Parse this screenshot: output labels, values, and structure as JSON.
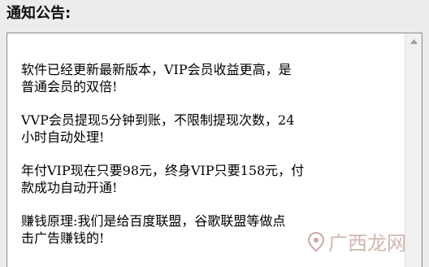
{
  "header": {
    "title": "通知公告:"
  },
  "notice": {
    "paragraphs": [
      "软件已经更新最新版本，VIP会员收益更高，是\n普通会员的双倍!",
      "VVP会员提现5分钟到账，不限制提现次数，24\n小时自动处理!",
      "年付VIP现在只要98元，终身VIP只要158元，付\n款成功自动开通!",
      "赚钱原理:我们是给百度联盟，谷歌联盟等做点\n击广告赚钱的!"
    ]
  },
  "watermark": {
    "text": "广西龙网"
  },
  "icons": {
    "scroll_up": "scroll-up-arrow-icon",
    "watermark_logo": "watermark-logo-icon"
  },
  "colors": {
    "background": "#ececec",
    "box": "#ffffff",
    "border": "#8a8a8a",
    "watermark": "#c9a9a0"
  }
}
